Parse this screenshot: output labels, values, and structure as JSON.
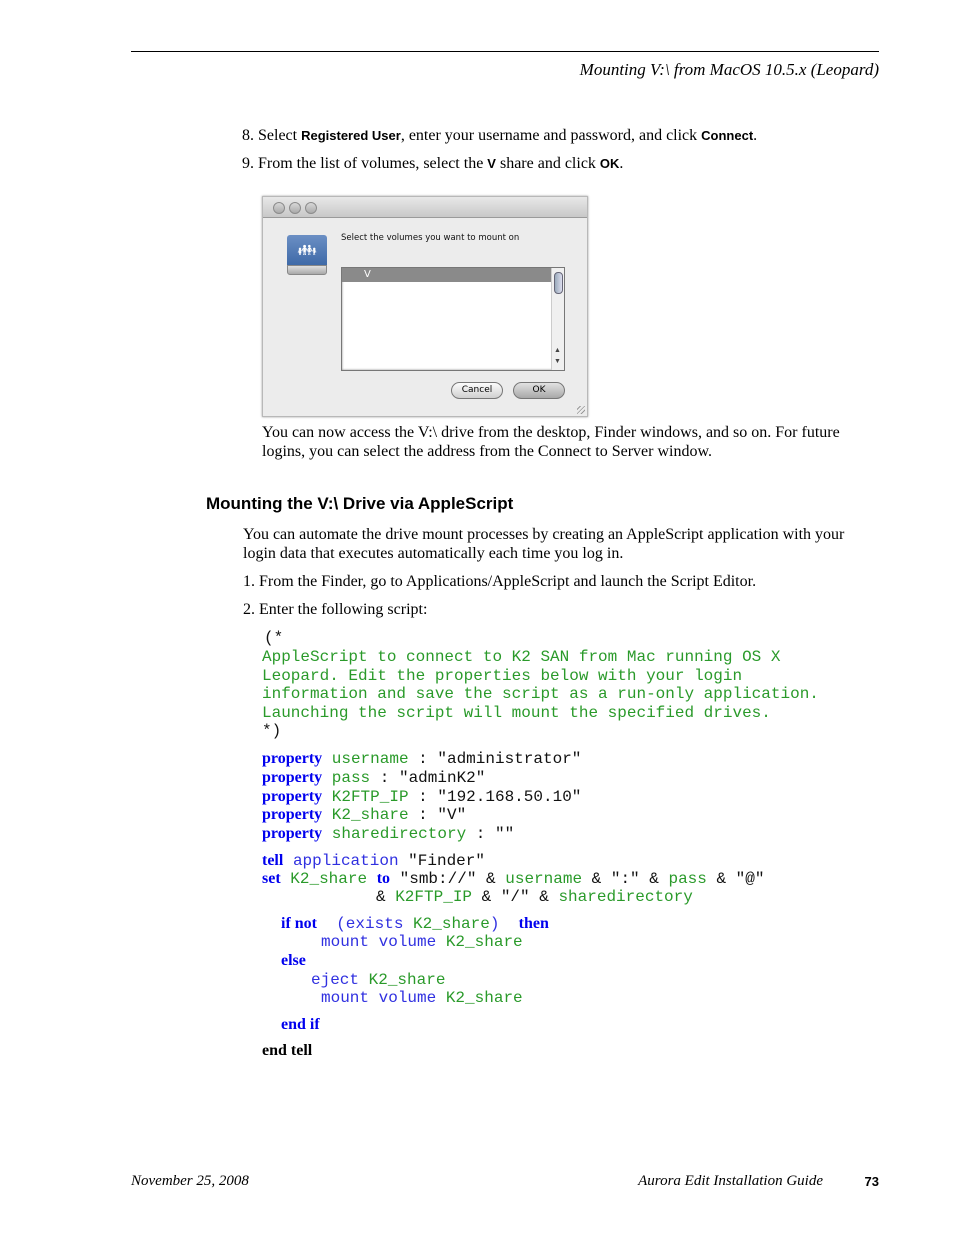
{
  "header": {
    "running_title": "Mounting V:\\ from MacOS 10.5.x (Leopard)"
  },
  "steps_a": [
    {
      "num": "8.",
      "pre": "Select ",
      "ui1": "Registered User",
      "mid": ", enter your username and password, and click ",
      "ui2": "Connect",
      "post": "."
    },
    {
      "num": "9.",
      "pre": "From the list of volumes, select the ",
      "ui1": "V",
      "mid": " share and click ",
      "ui2": "OK",
      "post": "."
    }
  ],
  "dialog": {
    "icon": "network-drive-icon",
    "prompt": "Select the volumes you want to mount on",
    "volumes": [
      "V"
    ],
    "cancel_label": "Cancel",
    "ok_label": "OK"
  },
  "after_dialog": "You can now access the V:\\ drive from the desktop, Finder windows, and so on. For future logins, you can select the address from the Connect to Server window.",
  "section": {
    "title": "Mounting the V:\\ Drive via AppleScript",
    "intro": "You can automate the drive mount processes by creating an AppleScript application with your login data that executes automatically each time you log in.",
    "steps": [
      "1. From the Finder, go to Applications/AppleScript and launch the Script Editor.",
      "2. Enter the following script:"
    ]
  },
  "script": {
    "comment_open": "(*",
    "comment_lines": [
      "AppleScript to connect to K2 SAN from Mac running OS X",
      "Leopard. Edit the properties below with your login",
      "information and save the script as a run-only application.",
      "Launching the script will mount the specified drives."
    ],
    "comment_close": "*)",
    "kw_property": "property",
    "properties": [
      {
        "name": "username",
        "value": " : \"administrator\""
      },
      {
        "name": "pass",
        "value": " : \"adminK2\""
      },
      {
        "name": "K2FTP_IP",
        "value": " : \"192.168.50.10\""
      },
      {
        "name": "K2_share",
        "value": " : \"V\""
      },
      {
        "name": "sharedirectory",
        "value": " : \"\""
      }
    ],
    "tell_kw": "tell",
    "tell_app": "application",
    "tell_target": " \"Finder\"",
    "set_kw": "set",
    "set_var": "K2_share",
    "to_kw": "to",
    "smb": " \"smb://\" & ",
    "v_username": "username",
    "colon": " & \":\" & ",
    "v_pass": "pass",
    "at": " & \"@\"",
    "cont_amp": "& ",
    "v_ip": "K2FTP_IP",
    "slash": " & \"/\" & ",
    "v_dir": "sharedirectory",
    "if_not": "if not",
    "exists_open": "(exists",
    "exists_var": "K2_share",
    "exists_close": ")",
    "then": "then",
    "mount_volume": "mount volume",
    "else": "else",
    "eject": "eject",
    "end_if": "end if",
    "end_tell": "end tell"
  },
  "footer": {
    "date": "November 25, 2008",
    "doc_title": "Aurora Edit Installation Guide",
    "page": "73"
  }
}
